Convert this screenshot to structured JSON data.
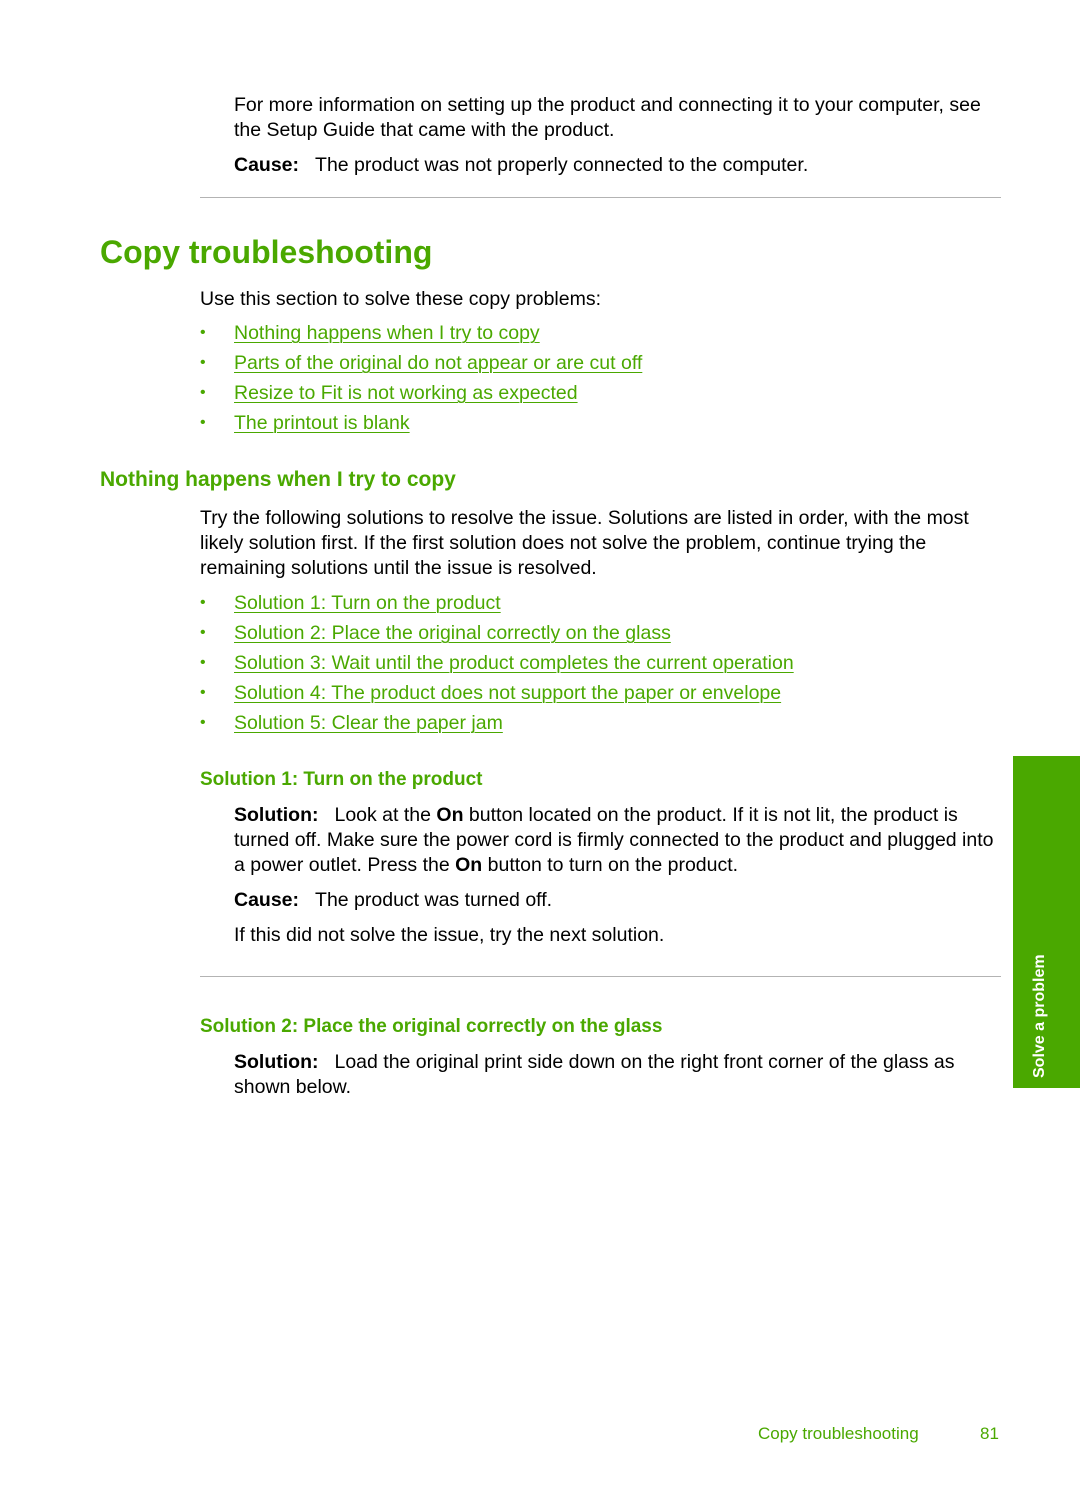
{
  "intro": {
    "paragraph": "For more information on setting up the product and connecting it to your computer, see the Setup Guide that came with the product.",
    "cause_label": "Cause:",
    "cause_text": "The product was not properly connected to the computer."
  },
  "section": {
    "title": "Copy troubleshooting",
    "intro": "Use this section to solve these copy problems:",
    "links": [
      "Nothing happens when I try to copy",
      "Parts of the original do not appear or are cut off",
      "Resize to Fit is not working as expected",
      "The printout is blank"
    ]
  },
  "subsection": {
    "title": "Nothing happens when I try to copy",
    "intro": "Try the following solutions to resolve the issue. Solutions are listed in order, with the most likely solution first. If the first solution does not solve the problem, continue trying the remaining solutions until the issue is resolved.",
    "links": [
      "Solution 1: Turn on the product",
      "Solution 2: Place the original correctly on the glass",
      "Solution 3: Wait until the product completes the current operation",
      "Solution 4: The product does not support the paper or envelope",
      "Solution 5: Clear the paper jam"
    ]
  },
  "solution1": {
    "title": "Solution 1: Turn on the product",
    "solution_label": "Solution:",
    "text_part1": "Look at the ",
    "on1": "On",
    "text_part2": " button located on the product. If it is not lit, the product is turned off. Make sure the power cord is firmly connected to the product and plugged into a power outlet. Press the ",
    "on2": "On",
    "text_part3": " button to turn on the product.",
    "cause_label": "Cause:",
    "cause_text": "The product was turned off.",
    "next": "If this did not solve the issue, try the next solution."
  },
  "solution2": {
    "title": "Solution 2: Place the original correctly on the glass",
    "solution_label": "Solution:",
    "text": "Load the original print side down on the right front corner of the glass as shown below."
  },
  "side_tab": {
    "label": "Solve a problem"
  },
  "footer": {
    "section": "Copy troubleshooting",
    "page": "81"
  },
  "colors": {
    "accent": "#4aa800",
    "rule": "#b3b3b3"
  }
}
